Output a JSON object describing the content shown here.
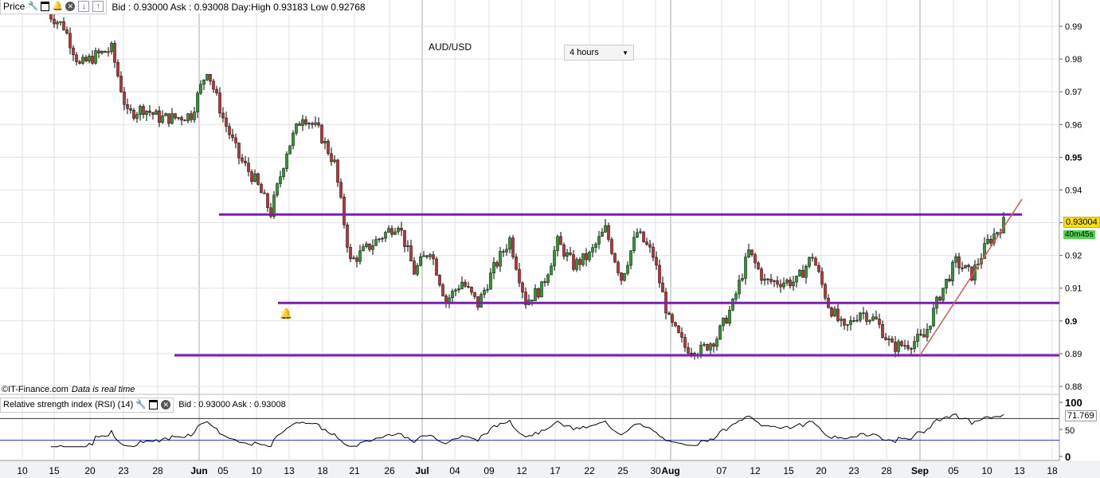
{
  "toolbar": {
    "label": "Price",
    "quote": "Bid : 0.93000 Ask : 0.93008 Day:High 0.93183 Low 0.92768"
  },
  "title": "AUD/USD",
  "timeframe": "4 hours",
  "credit": {
    "site": "©IT-Finance.com",
    "note": "Data is real time"
  },
  "rsi_bar": {
    "label": "Relative strength index (RSI) (14)",
    "quote": "Bid : 0.93000 Ask : 0.93008"
  },
  "last_price": "0.93004",
  "countdown": "40m45s",
  "rsi_value": "71.769",
  "colors": {
    "support": "#7a1fb0",
    "trend": "#e05555",
    "bull": "#2a9a2a",
    "bear": "#c03030"
  },
  "chart_data": {
    "type": "candlestick",
    "title": "AUD/USD",
    "timeframe": "4 hours",
    "price_ticks": [
      "0.99",
      "0.98",
      "0.97",
      "0.96",
      "0.95",
      "0.94",
      "0.93",
      "0.92",
      "0.91",
      "0.9",
      "0.89",
      "0.88"
    ],
    "ylim": [
      0.88,
      0.99
    ],
    "x_ticks": [
      "10",
      "15",
      "20",
      "23",
      "28",
      "Jun",
      "05",
      "10",
      "13",
      "18",
      "21",
      "26",
      "Jul",
      "04",
      "09",
      "12",
      "17",
      "22",
      "25",
      "30",
      "Aug",
      "07",
      "12",
      "15",
      "20",
      "23",
      "28",
      "Sep",
      "05",
      "10",
      "13",
      "18"
    ],
    "close_path": [
      0.994,
      0.99,
      0.978,
      0.981,
      0.983,
      0.963,
      0.965,
      0.962,
      0.962,
      0.963,
      0.977,
      0.962,
      0.95,
      0.943,
      0.933,
      0.952,
      0.963,
      0.958,
      0.948,
      0.918,
      0.922,
      0.926,
      0.93,
      0.915,
      0.922,
      0.906,
      0.912,
      0.905,
      0.916,
      0.925,
      0.906,
      0.91,
      0.924,
      0.917,
      0.92,
      0.928,
      0.913,
      0.927,
      0.92,
      0.9,
      0.892,
      0.891,
      0.895,
      0.905,
      0.921,
      0.912,
      0.912,
      0.912,
      0.92,
      0.905,
      0.897,
      0.903,
      0.9,
      0.892,
      0.893,
      0.895,
      0.908,
      0.918,
      0.914,
      0.924,
      0.93
    ],
    "horizontal_levels": [
      0.9325,
      0.9055,
      0.8895
    ],
    "rsi": {
      "ticks": [
        "100",
        "50",
        "0"
      ],
      "levels": [
        70,
        30
      ]
    }
  }
}
